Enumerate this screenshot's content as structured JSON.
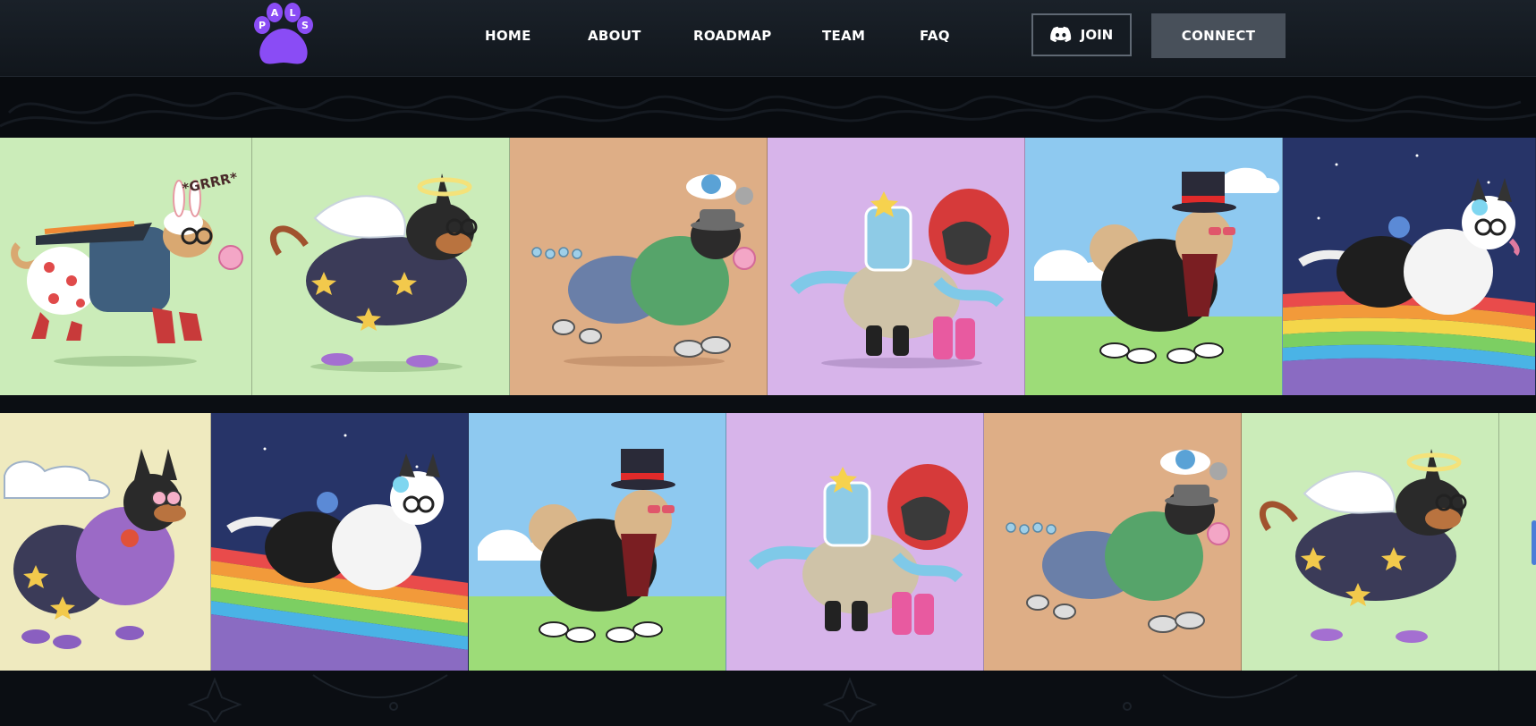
{
  "header": {
    "logo_text": "PALS",
    "nav": [
      {
        "label": "HOME"
      },
      {
        "label": "ABOUT"
      },
      {
        "label": "ROADMAP"
      },
      {
        "label": "TEAM"
      },
      {
        "label": "FAQ"
      }
    ],
    "join_label": "JOIN",
    "join_icon": "discord-icon",
    "connect_label": "CONNECT"
  },
  "gallery": {
    "row1": [
      {
        "bg": "#cbecb9",
        "theme": "bunny-hat-jetpack-dog",
        "bubble": "*GRRR*"
      },
      {
        "bg": "#cbecb9",
        "theme": "angel-wings-doberman"
      },
      {
        "bg": "#deae86",
        "theme": "green-hoodie-earth-hat-dog"
      },
      {
        "bg": "#d7b4ea",
        "theme": "red-helmet-robot-dog"
      },
      {
        "bg": "#8ec9f0",
        "theme": "top-hat-suit-dog"
      },
      {
        "bg": "#273468",
        "theme": "rainbow-husky"
      }
    ],
    "row2": [
      {
        "bg": "#efeabf",
        "theme": "purple-hoodie-headphones-dog"
      },
      {
        "bg": "#273468",
        "theme": "rainbow-husky"
      },
      {
        "bg": "#8ec9f0",
        "theme": "top-hat-suit-dog"
      },
      {
        "bg": "#d7b4ea",
        "theme": "red-helmet-robot-dog"
      },
      {
        "bg": "#deae86",
        "theme": "green-hoodie-earth-hat-dog"
      },
      {
        "bg": "#cbecb9",
        "theme": "angel-wings-doberman"
      },
      {
        "bg": "#cbecb9",
        "theme": "partial-tile"
      }
    ]
  },
  "colors": {
    "header_bg": "#161c23",
    "page_bg": "#0b0e13",
    "logo_purple": "#8a4cf5",
    "connect_bg": "#48505a"
  }
}
